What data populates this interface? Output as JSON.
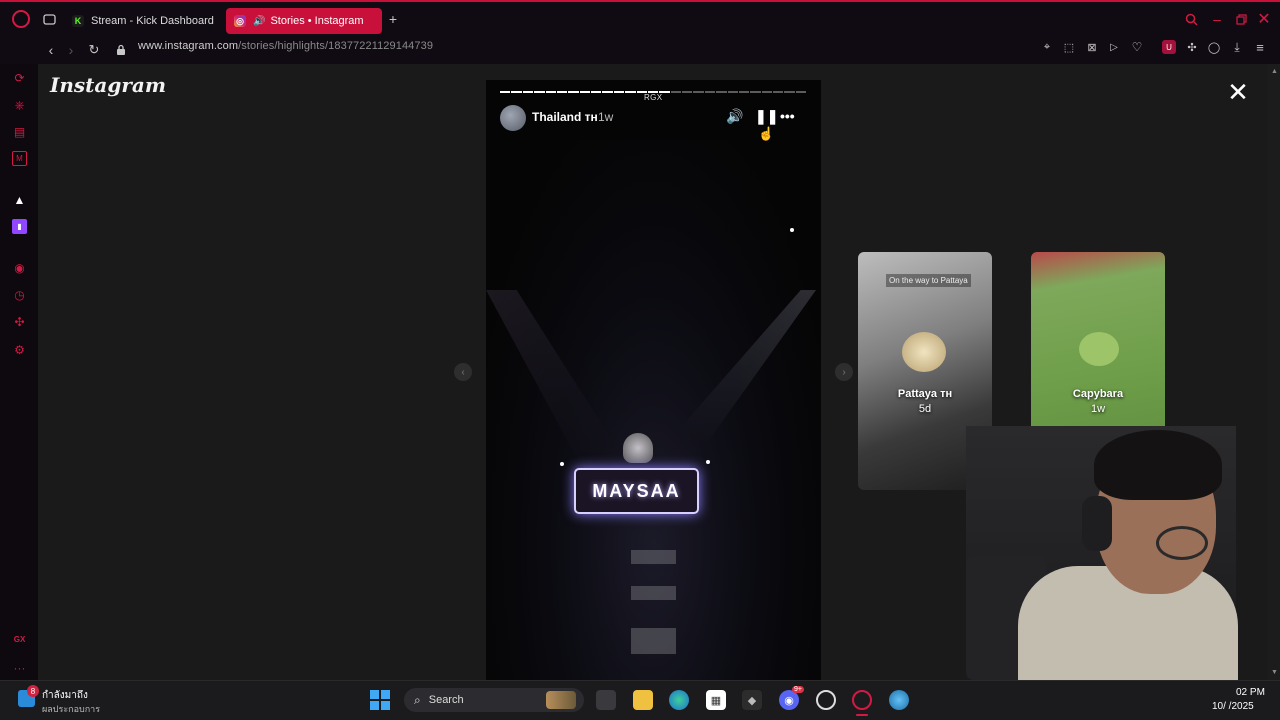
{
  "browser": {
    "tabs": [
      {
        "label": "Stream - Kick Dashboard",
        "active": false,
        "favicon": "kick-icon"
      },
      {
        "label": "Stories • Instagram",
        "active": true,
        "favicon": "instagram-icon"
      }
    ],
    "url_host": "www.instagram.com",
    "url_path": "/stories/highlights/18377221129144739",
    "accent_color": "#c8103a"
  },
  "sidebar": {
    "items": [
      "speed-dial-icon",
      "bookmarks-icon",
      "news-icon",
      "gmail-icon",
      "aria-icon",
      "twitch-icon",
      "player-icon",
      "history-icon",
      "extensions-icon",
      "settings-icon"
    ],
    "gx_label": "GX",
    "more_label": "···"
  },
  "instagram": {
    "logo_text": "Instagram",
    "story": {
      "overlay_label": "RGX",
      "username": "Thailand ᴛʜ",
      "time_ago": "1w",
      "booth_text": "MAYSAA",
      "progress_total": 27,
      "progress_done": 15
    },
    "next_highlights": [
      {
        "title": "Pattaya ᴛʜ",
        "age": "5d",
        "tag": "On the way to Pattaya"
      },
      {
        "title": "Capybara",
        "age": "1w"
      }
    ]
  },
  "taskbar": {
    "weather_line1": "กำลังมาถึง",
    "weather_line2": "ผลประกอบการ",
    "notification_count": "8",
    "search_label": "Search",
    "clock_time": "02 PM",
    "clock_date": "10/ /2025",
    "discord_badge": "9+"
  }
}
